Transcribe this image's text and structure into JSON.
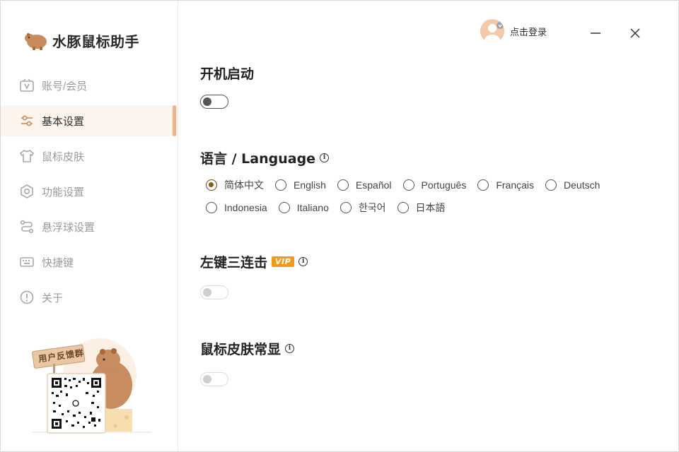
{
  "app": {
    "name": "水豚鼠标助手"
  },
  "header": {
    "login_label": "点击登录"
  },
  "sidebar": {
    "items": [
      {
        "label": "账号/会员",
        "icon": "member-icon",
        "active": false
      },
      {
        "label": "基本设置",
        "icon": "settings-sliders-icon",
        "active": true
      },
      {
        "label": "鼠标皮肤",
        "icon": "shirt-icon",
        "active": false
      },
      {
        "label": "功能设置",
        "icon": "hexagon-gear-icon",
        "active": false
      },
      {
        "label": "悬浮球设置",
        "icon": "route-icon",
        "active": false
      },
      {
        "label": "快捷键",
        "icon": "keyboard-icon",
        "active": false
      },
      {
        "label": "关于",
        "icon": "info-circle-icon",
        "active": false
      }
    ],
    "promo": {
      "sign_text": "用户反馈群"
    }
  },
  "sections": {
    "startup": {
      "title": "开机启动",
      "enabled": false
    },
    "language": {
      "title": "语言 / Language",
      "selected": "简体中文",
      "options_row1": [
        "简体中文",
        "English",
        "Español",
        "Português",
        "Français",
        "Deutsch"
      ],
      "options_row2": [
        "Indonesia",
        "Italiano",
        "한국어",
        "日本語"
      ]
    },
    "triple_click": {
      "title": "左键三连击",
      "badge": "VIP",
      "enabled": false
    },
    "skin_always": {
      "title": "鼠标皮肤常显",
      "enabled": false
    }
  },
  "colors": {
    "accent": "#e9b48f",
    "active_bg": "#fcf4ed",
    "vip": "#f39a1a",
    "radio_checked": "#8a5c12"
  }
}
